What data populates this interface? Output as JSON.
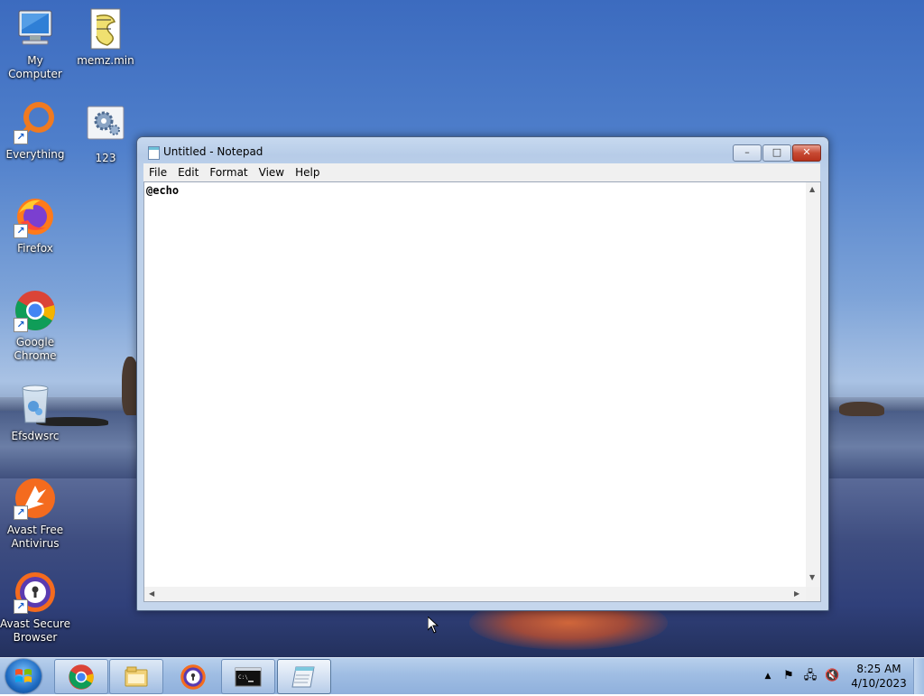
{
  "desktop": {
    "icons": [
      {
        "label": "My Computer"
      },
      {
        "label": "memz.min"
      },
      {
        "label": "Everything"
      },
      {
        "label": "123"
      },
      {
        "label": "Firefox"
      },
      {
        "label": "Google Chrome"
      },
      {
        "label": "Efsdwsrc"
      },
      {
        "label": "Avast Free Antivirus"
      },
      {
        "label": "Avast Secure Browser"
      }
    ]
  },
  "notepad": {
    "title": "Untitled - Notepad",
    "menu": [
      "File",
      "Edit",
      "Format",
      "View",
      "Help"
    ],
    "content": "@echo",
    "buttons": {
      "minimize": "–",
      "maximize": "□",
      "close": "✕"
    }
  },
  "taskbar": {
    "items": [
      "google-chrome",
      "windows-explorer",
      "avast-secure-browser",
      "command-prompt",
      "notepad"
    ],
    "active_item": "notepad",
    "clock_time": "8:25 AM",
    "clock_date": "4/10/2023"
  },
  "colors": {
    "taskbar": "#9fbde3",
    "window_frame": "#bcd0ea",
    "close_button": "#c74a33"
  }
}
